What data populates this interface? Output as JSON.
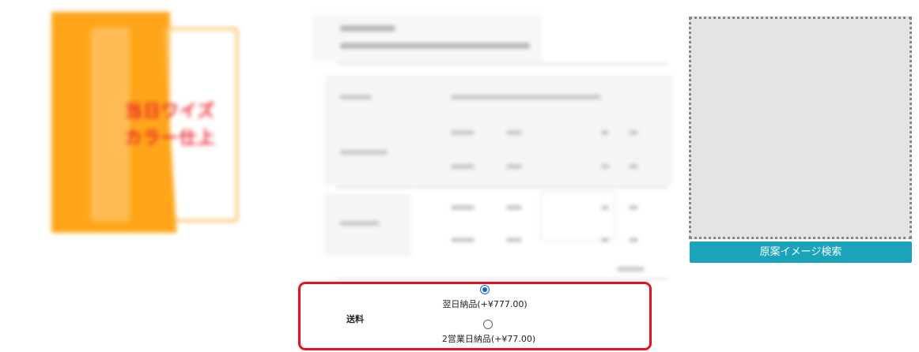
{
  "product_image": {
    "caption_line1": "当日ワイズ",
    "caption_line2": "カラー仕上"
  },
  "shipping": {
    "label": "送料",
    "options": [
      {
        "label": "翌日納品(+¥777.00)",
        "selected": true
      },
      {
        "label": "2営業日納品(+¥77.00)",
        "selected": false
      }
    ]
  },
  "image_search": {
    "button_label": "原案イメージ検索"
  },
  "colors": {
    "product_orange": "#ffa51a",
    "highlight_red": "#e8111b",
    "button_teal": "#1aa3b9",
    "radio_blue": "#0a6cd6"
  }
}
